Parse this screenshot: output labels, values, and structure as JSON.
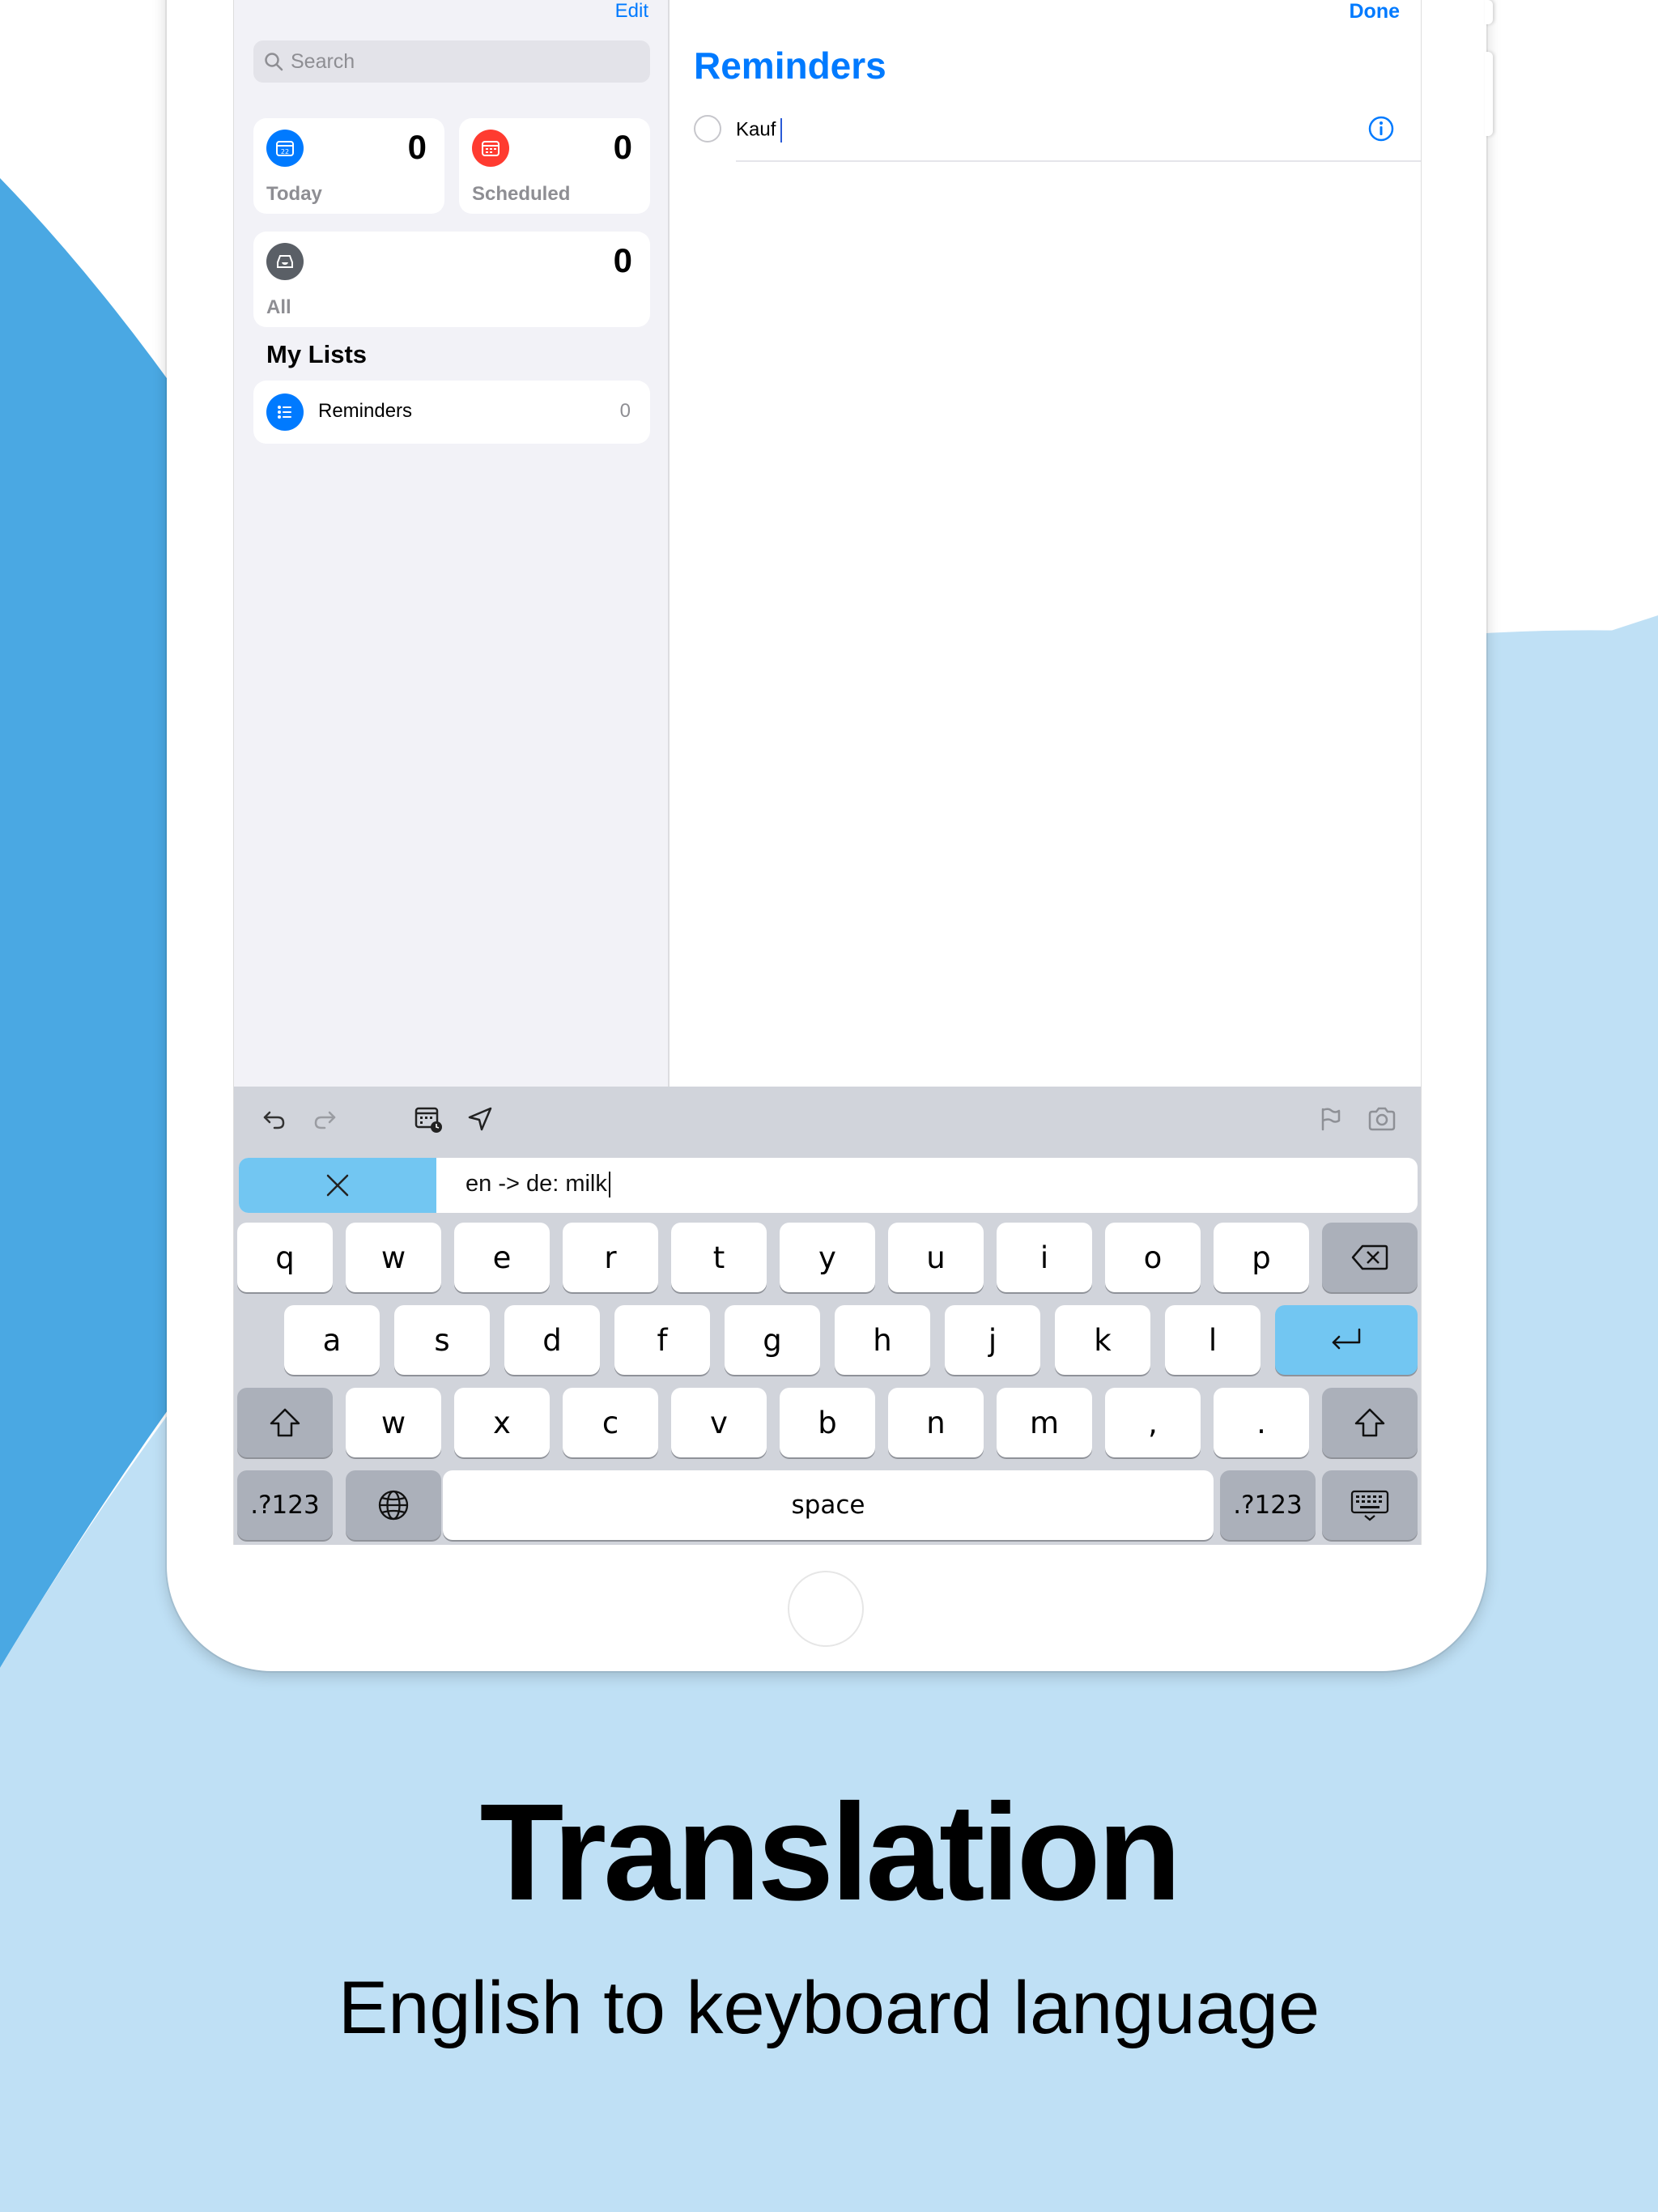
{
  "colors": {
    "accent": "#007aff",
    "background_blue": "#4aa8e3",
    "background_light": "#bfe0f5",
    "translate_highlight": "#72c6f2"
  },
  "sidebar": {
    "edit_label": "Edit",
    "search_placeholder": "Search",
    "smart_lists": [
      {
        "label": "Today",
        "count": "0",
        "icon": "calendar-today-icon"
      },
      {
        "label": "Scheduled",
        "count": "0",
        "icon": "calendar-scheduled-icon"
      },
      {
        "label": "All",
        "count": "0",
        "icon": "tray-icon"
      }
    ],
    "my_lists_title": "My Lists",
    "lists": [
      {
        "name": "Reminders",
        "count": "0",
        "icon": "list-icon"
      }
    ]
  },
  "detail": {
    "done_label": "Done",
    "title": "Reminders",
    "items": [
      {
        "text": "Kauf"
      }
    ]
  },
  "keyboard": {
    "translation_text": "en -> de: milk",
    "row1": [
      "q",
      "w",
      "e",
      "r",
      "t",
      "y",
      "u",
      "i",
      "o",
      "p"
    ],
    "row2": [
      "a",
      "s",
      "d",
      "f",
      "g",
      "h",
      "j",
      "k",
      "l"
    ],
    "row3": [
      "w",
      "x",
      "c",
      "v",
      "b",
      "n",
      "m",
      ",",
      "."
    ],
    "numbers_label": ".?123",
    "space_label": "space"
  },
  "caption": {
    "title": "Translation",
    "subtitle": "English to keyboard language"
  }
}
